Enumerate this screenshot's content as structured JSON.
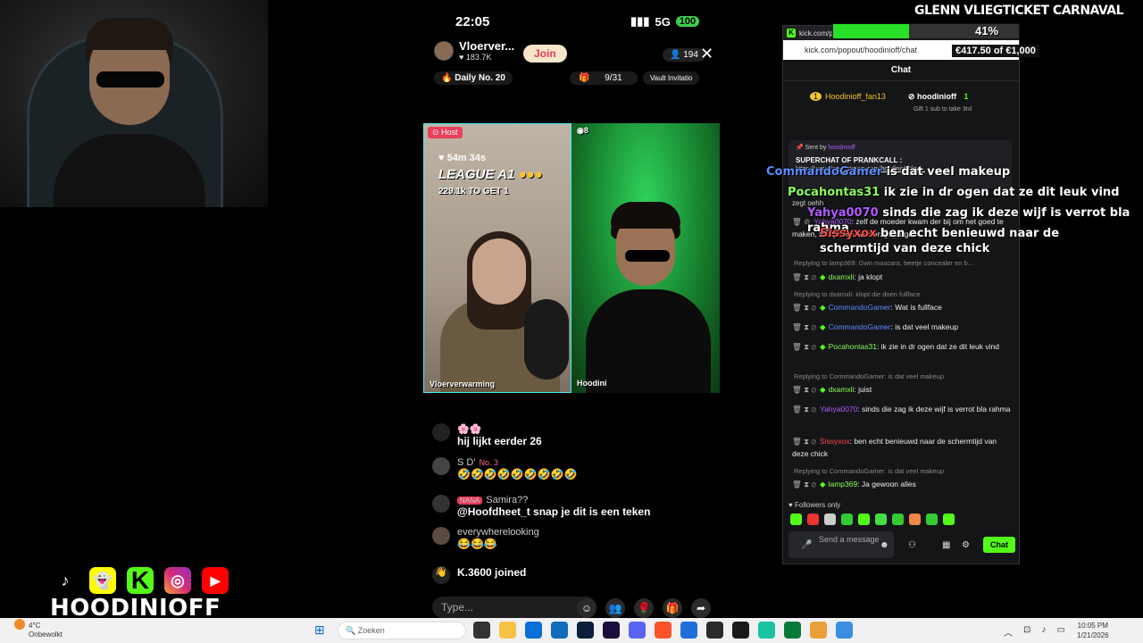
{
  "overlay": {
    "banner_title": "GLENN VLIEGTICKET CARNAVAL",
    "goal_percent_label": "41%",
    "goal_fraction": 0.41,
    "goal_amount": "€417.50 of €1,000",
    "brand_name": "HOODINIOFF",
    "floating_messages": [
      {
        "user": "CommandoGamer",
        "text": "is dat veel makeup",
        "user_color": "#5b8cff"
      },
      {
        "user": "Pocahontas31",
        "text": "ik zie in dr ogen dat ze dit leuk vind",
        "user_color": "#8aff5b"
      },
      {
        "user": "Yahya0070",
        "text": "sinds die zag ik deze wijf is verrot bla rahma",
        "user_color": "#b15bff"
      },
      {
        "user": "Sissyxox",
        "text": "ben echt benieuwd naar de schermtijd van deze chick",
        "user_color": "#ff4b4b"
      }
    ]
  },
  "phone": {
    "time": "22:05",
    "network": "5G",
    "battery": "100",
    "host_name": "Vloerver...",
    "host_likes": "183.7K",
    "join_label": "Join",
    "viewer_count": "194",
    "daily_label": "Daily No. 20",
    "progress_label": "9/31",
    "vault_label": "Vault Invitatio",
    "host_tag": "Host",
    "rank_badge": "8",
    "timer": "54m 34s",
    "league": "LEAGUE A1",
    "league_sub": "229.1k TO GET 1",
    "left_video_name": "Vloerverwarming",
    "right_video_name": "Hoodini",
    "comments": [
      {
        "name": "",
        "text": "hij lijkt eerder 26"
      },
      {
        "name": "S D'",
        "badge": "No. 3",
        "text": "🤣🤣🤣🤣🤣🤣🤣🤣🤣"
      },
      {
        "name": "Samira??",
        "badge": "NANA",
        "text": "@Hoofdheet_t snap je dit is een teken"
      },
      {
        "name": "everywherelooking",
        "text": "😂😂😂"
      },
      {
        "name": "",
        "text": "K.3600 joined"
      }
    ],
    "type_placeholder": "Type..."
  },
  "browser": {
    "tab_label": "kick.com/p",
    "url": "kick.com/popout/hoodinioff/chat",
    "chat_title": "Chat",
    "top_gifter": "Hoodinioff_fan13",
    "top_gifter_count": "1",
    "second_gifter": "hoodinioff",
    "second_gifter_count": "1",
    "gift_cta": "Gift 1 sub to take 3rd",
    "pinned_sender_prefix": "Sent by",
    "pinned_sender": "hoodinioff",
    "pinned_title": "SUPERCHAT OF PRANKCALL :",
    "pinned_link": "https://www.tipeeestream.com/hoodinioff/don...",
    "chat_lines": [
      {
        "user": "",
        "text": "zegt oehh"
      },
      {
        "user": "Yahya0070",
        "text": "zelf de moeder kwam der bij om het goed te maken, beetje conealer en go jongen",
        "color": "#b15bff"
      },
      {
        "reply": "Replying to lamp369: Gwn mascara, beetje concealer en b..."
      },
      {
        "user": "dxamxli",
        "text": "ja klopt",
        "color": "#8aff5b"
      },
      {
        "reply": "Replying to dxamxli: klopt die doen fullface"
      },
      {
        "user": "CommandoGamer",
        "text": "Wat is fullface",
        "color": "#5b8cff"
      },
      {
        "user": "CommandoGamer",
        "text": "is dat veel makeup",
        "color": "#5b8cff"
      },
      {
        "user": "Pocahontas31",
        "text": "ik zie in dr ogen dat ze dit leuk vind",
        "color": "#8aff5b"
      },
      {
        "reply": "Replying to CommandoGamer: is dat veel makeup"
      },
      {
        "user": "dxamxli",
        "text": "juist",
        "color": "#8aff5b"
      },
      {
        "user": "Yahya0070",
        "text": "sinds die zag ik deze wijf is verrot bla rahma",
        "color": "#b15bff"
      },
      {
        "user": "Sissyxox",
        "text": "ben echt benieuwd naar de schermtijd van deze chick",
        "color": "#ff4b4b"
      },
      {
        "reply": "Replying to CommandoGamer: is dat veel makeup"
      },
      {
        "user": "lamp369",
        "text": "Ja gewoon alles",
        "color": "#8aff5b"
      }
    ],
    "followers_only": "Followers only",
    "send_placeholder": "Send a message",
    "chat_button": "Chat"
  },
  "taskbar": {
    "temperature": "4°C",
    "weather": "Onbewolkt",
    "search_placeholder": "Zoeken",
    "time": "10:05 PM",
    "date": "1/21/2026"
  }
}
